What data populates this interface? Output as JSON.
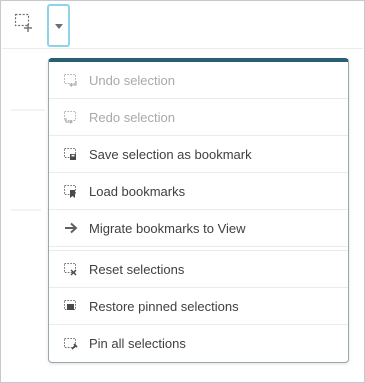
{
  "colors": {
    "accent_border": "#8fd3e8",
    "menu_top_bar": "#2a5f73",
    "text": "#404040",
    "disabled_text": "#a9a9a9",
    "icon_gray": "#707070"
  },
  "toolbar": {
    "selection_tool_icon": "selection-add-icon",
    "dropdown_icon": "caret-down-icon"
  },
  "menu": {
    "items": [
      {
        "label": "Undo selection",
        "icon": "undo-selection-icon",
        "disabled": true
      },
      {
        "label": "Redo selection",
        "icon": "redo-selection-icon",
        "disabled": true
      },
      {
        "label": "Save selection as bookmark",
        "icon": "save-bookmark-icon",
        "disabled": false
      },
      {
        "label": "Load bookmarks",
        "icon": "load-bookmarks-icon",
        "disabled": false
      },
      {
        "label": "Migrate bookmarks to View",
        "icon": "arrow-right-icon",
        "disabled": false
      },
      {
        "label": "Reset selections",
        "icon": "reset-selections-icon",
        "disabled": false
      },
      {
        "label": "Restore pinned selections",
        "icon": "restore-pinned-icon",
        "disabled": false
      },
      {
        "label": "Pin all selections",
        "icon": "pin-selections-icon",
        "disabled": false
      }
    ]
  }
}
